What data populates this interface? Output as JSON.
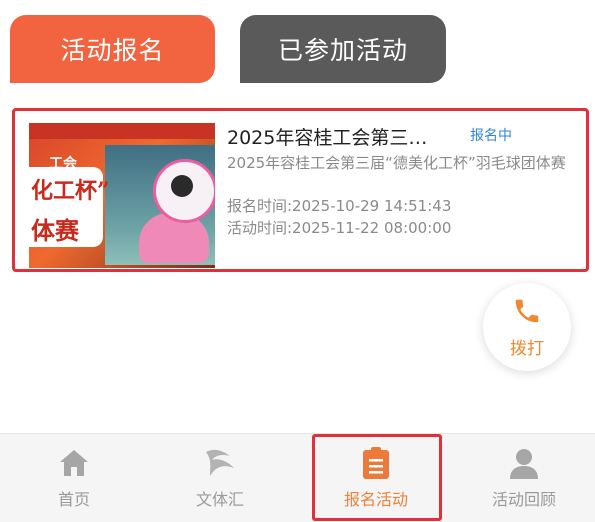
{
  "tabs": {
    "active_label": "活动报名",
    "inactive_label": "已参加活动"
  },
  "activity": {
    "title": "2025年容桂工会第三…",
    "status": "报名中",
    "description": "2025年容桂工会第三届“德美化工杯”羽毛球团体赛",
    "signup_time": "报名时间:2025-10-29 14:51:43",
    "event_time": "活动时间:2025-11-22 08:00:00",
    "thumbnail": {
      "line1": "工会",
      "line2": "化工杯”",
      "line3": "体赛"
    }
  },
  "call_button": {
    "label": "拨打",
    "icon": "phone-icon"
  },
  "bottom_nav": {
    "items": [
      {
        "label": "首页",
        "icon": "home-icon"
      },
      {
        "label": "文体汇",
        "icon": "swoosh-icon"
      },
      {
        "label": "报名活动",
        "icon": "clipboard-icon"
      },
      {
        "label": "活动回顾",
        "icon": "user-icon"
      }
    ]
  },
  "colors": {
    "accent": "#f2643f",
    "inactive_tab": "#5a5a5a",
    "highlight_border": "#e0303c",
    "status_blue": "#2f86d6",
    "nav_active": "#f0813a"
  }
}
